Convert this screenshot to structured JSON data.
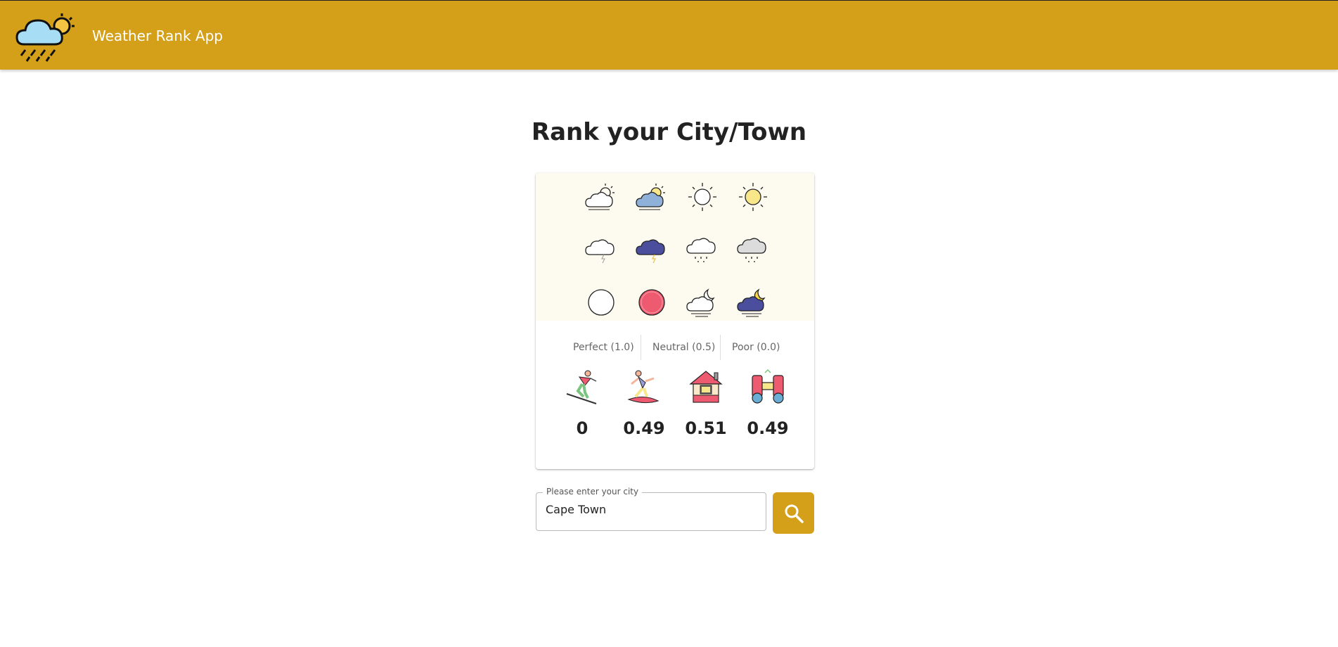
{
  "app": {
    "title": "Weather Rank App",
    "logo_icon": "weather-rain-sun-icon",
    "accent": "#d4a01a"
  },
  "page": {
    "title": "Rank your City/Town"
  },
  "legend": {
    "weather_icons": [
      "partly-cloudy-outline-icon",
      "partly-cloudy-color-icon",
      "sun-outline-icon",
      "sun-color-icon",
      "thunder-cloud-outline-icon",
      "thunder-cloud-color-icon",
      "rain-cloud-outline-icon",
      "rain-cloud-color-icon",
      "circle-outline-icon",
      "circle-color-icon",
      "night-cloud-outline-icon",
      "night-cloud-color-icon"
    ],
    "ratings": [
      "Perfect (1.0)",
      "Neutral (0.5)",
      "Poor (0.0)"
    ]
  },
  "activities": [
    {
      "icon": "skiing-icon",
      "score": "0"
    },
    {
      "icon": "surfing-icon",
      "score": "0.49"
    },
    {
      "icon": "house-icon",
      "score": "0.51"
    },
    {
      "icon": "binoculars-icon",
      "score": "0.49"
    }
  ],
  "search": {
    "label": "Please enter your city",
    "value": "Cape Town",
    "icon": "search-icon"
  }
}
